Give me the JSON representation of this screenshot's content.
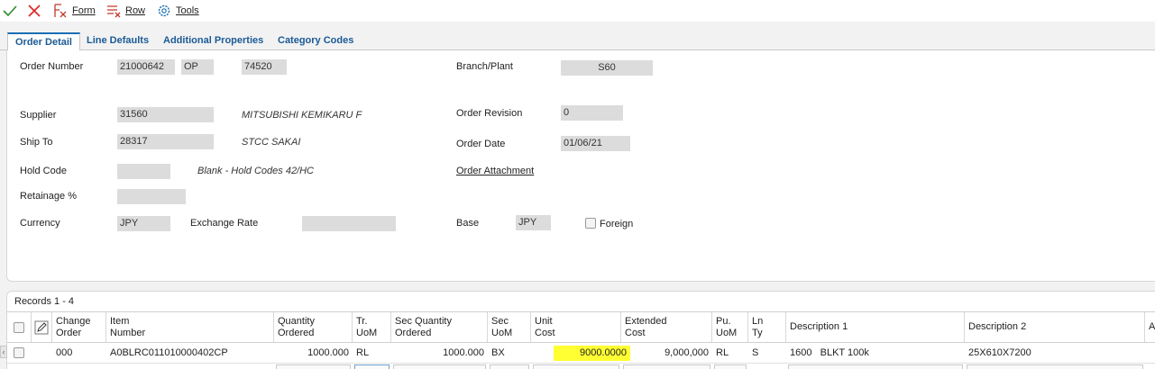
{
  "toolbar": {
    "form_label": "Form",
    "row_label": "Row",
    "tools_label": "Tools"
  },
  "tabs": [
    {
      "label": "Order Detail"
    },
    {
      "label": "Line Defaults"
    },
    {
      "label": "Additional Properties"
    },
    {
      "label": "Category Codes"
    }
  ],
  "form": {
    "order_number_label": "Order Number",
    "order_number": "21000642",
    "order_type": "OP",
    "order_company": "74520",
    "branch_plant_label": "Branch/Plant",
    "branch_plant": "S60",
    "supplier_label": "Supplier",
    "supplier": "31560",
    "supplier_name": "MITSUBISHI KEMIKARU F",
    "order_revision_label": "Order Revision",
    "order_revision": "0",
    "ship_to_label": "Ship To",
    "ship_to": "28317",
    "ship_to_name": "STCC SAKAI",
    "order_date_label": "Order Date",
    "order_date": "01/06/21",
    "hold_code_label": "Hold Code",
    "hold_code": "",
    "hold_code_desc": "Blank - Hold Codes 42/HC",
    "order_attachment_label": "Order Attachment",
    "retainage_label": "Retainage %",
    "retainage": "",
    "currency_label": "Currency",
    "currency": "JPY",
    "exchange_rate_label": "Exchange Rate",
    "exchange_rate": "",
    "base_label": "Base",
    "base": "JPY",
    "foreign_label": "Foreign"
  },
  "grid": {
    "records_label": "Records 1 - 4",
    "columns": [
      {
        "l1": "Change",
        "l2": "Order"
      },
      {
        "l1": "Item",
        "l2": "Number"
      },
      {
        "l1": "Quantity",
        "l2": "Ordered"
      },
      {
        "l1": "Tr.",
        "l2": "UoM"
      },
      {
        "l1": "Sec Quantity",
        "l2": "Ordered"
      },
      {
        "l1": "Sec",
        "l2": "UoM"
      },
      {
        "l1": "Unit",
        "l2": "Cost"
      },
      {
        "l1": "Extended",
        "l2": "Cost"
      },
      {
        "l1": "Pu.",
        "l2": "UoM"
      },
      {
        "l1": "Ln",
        "l2": "Ty"
      },
      {
        "l1": "Description 1",
        "l2": ""
      },
      {
        "l1": "Description 2",
        "l2": ""
      },
      {
        "l1": "A",
        "l2": ""
      }
    ],
    "rows": [
      {
        "change_order": "000",
        "item_number": "A0BLRC011010000402CP",
        "quantity_ordered": "1000.000",
        "tr_uom": "RL",
        "sec_quantity": "1000.000",
        "sec_uom": "BX",
        "unit_cost": "9000.0000",
        "extended_cost": "9,000,000",
        "pu_uom": "RL",
        "ln_ty": "S",
        "description_1": "1600   BLKT 100k",
        "description_2": "25X610X7200"
      }
    ]
  },
  "colors": {
    "accent": "#1a6fb5",
    "highlight": "#ffff33",
    "field_bg": "#dcdcdc"
  }
}
